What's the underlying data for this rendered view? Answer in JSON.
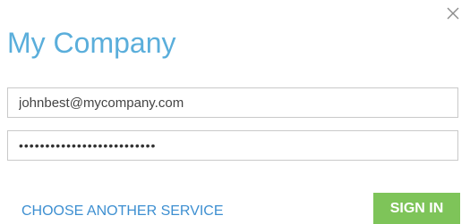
{
  "dialog": {
    "title": "My Company",
    "close_icon": "close-icon",
    "email": {
      "value": "johnbest@mycompany.com"
    },
    "password": {
      "value": "••••••••••••••••••••••••••"
    },
    "choose_service_label": "CHOOSE ANOTHER SERVICE",
    "signin_label": "SIGN IN"
  },
  "colors": {
    "title": "#5aaedb",
    "link": "#3d8fd1",
    "button": "#7ec459",
    "border": "#c9c9c9"
  }
}
